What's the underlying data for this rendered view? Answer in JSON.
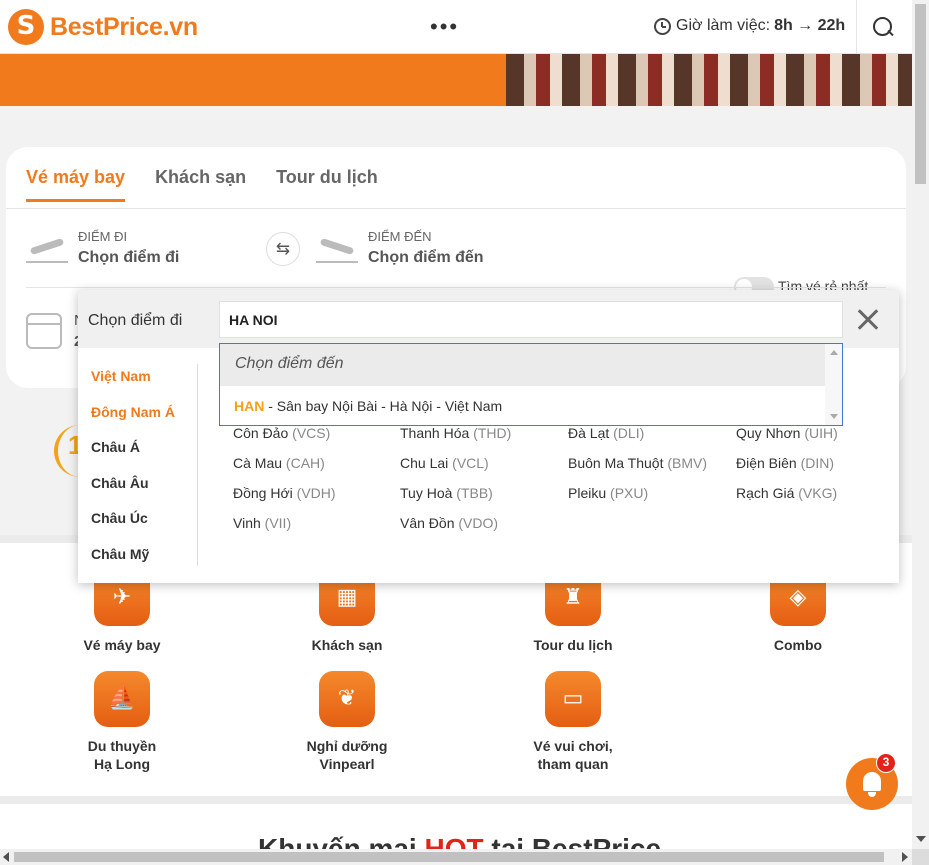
{
  "header": {
    "logo_text": "BestPrice.vn",
    "more": "•••",
    "hours_label": "Giờ làm việc:",
    "hours_value": "8h → 22h"
  },
  "search_card": {
    "tabs": [
      {
        "label": "Vé máy bay",
        "active": true
      },
      {
        "label": "Khách sạn",
        "active": false
      },
      {
        "label": "Tour du lịch",
        "active": false
      }
    ],
    "origin": {
      "label": "ĐIỂM ĐI",
      "value": "Chọn điểm đi"
    },
    "destination": {
      "label": "ĐIỂM ĐẾN",
      "value": "Chọn điểm đến"
    },
    "swap_icon": "⇆",
    "cheapest_toggle_label": "Tìm vé rẻ nhất",
    "date_fragment_top": "N",
    "date_fragment_bottom": "2"
  },
  "dropdown": {
    "title": "Chọn điểm đi",
    "query": "HA NOI",
    "regions": [
      {
        "label": "Việt Nam",
        "active": true
      },
      {
        "label": "Đông Nam Á",
        "active": true
      },
      {
        "label": "Châu Á",
        "active": false
      },
      {
        "label": "Châu Âu",
        "active": false
      },
      {
        "label": "Châu Úc",
        "active": false
      },
      {
        "label": "Châu Mỹ",
        "active": false
      }
    ],
    "cities": [
      {
        "name": "Côn Đảo",
        "code": "(VCS)"
      },
      {
        "name": "Thanh Hóa",
        "code": "(THD)"
      },
      {
        "name": "Đà Lạt",
        "code": "(DLI)"
      },
      {
        "name": "Quy Nhơn",
        "code": "(UIH)"
      },
      {
        "name": "Cà Mau",
        "code": "(CAH)"
      },
      {
        "name": "Chu Lai",
        "code": "(VCL)"
      },
      {
        "name": "Buôn Ma Thuột",
        "code": "(BMV)"
      },
      {
        "name": "Điện Biên",
        "code": "(DIN)"
      },
      {
        "name": "Đồng Hới",
        "code": "(VDH)"
      },
      {
        "name": "Tuy Hoà",
        "code": "(TBB)"
      },
      {
        "name": "Pleiku",
        "code": "(PXU)"
      },
      {
        "name": "Rạch Giá",
        "code": "(VKG)"
      },
      {
        "name": "Vinh",
        "code": "(VII)"
      },
      {
        "name": "Vân Đồn",
        "code": "(VDO)"
      }
    ]
  },
  "autocomplete": {
    "placeholder": "Chọn điểm đến",
    "option_code": "HAN",
    "option_text": " - Sân bay Nội Bài - Hà Nội - Việt Nam"
  },
  "badge_number": "1",
  "services": [
    {
      "name": "Vé máy bay",
      "icon": "plane-icon",
      "glyph": "✈"
    },
    {
      "name": "Khách sạn",
      "icon": "hotel-icon",
      "glyph": "▦"
    },
    {
      "name": "Tour du lịch",
      "icon": "traveler-icon",
      "glyph": "♜"
    },
    {
      "name": "Combo",
      "icon": "tag-icon",
      "glyph": "◈"
    },
    {
      "name_line1": "Du thuyền",
      "name_line2": "Hạ Long",
      "icon": "cruise-icon",
      "glyph": "⛵"
    },
    {
      "name_line1": "Nghỉ dưỡng",
      "name_line2": "Vinpearl",
      "icon": "resort-icon",
      "glyph": "❦"
    },
    {
      "name_line1": "Vé vui chơi,",
      "name_line2": "tham quan",
      "icon": "ticket-icon",
      "glyph": "▭"
    }
  ],
  "promo": {
    "prefix": "Khuyến mại ",
    "hot": "HOT",
    "suffix": " tại BestPrice"
  },
  "notification_count": "3",
  "colors": {
    "brand": "#f07a1c",
    "hot": "#e2231a",
    "autocomplete_code": "#f5a11a",
    "focus_border": "#3d7bd9"
  }
}
